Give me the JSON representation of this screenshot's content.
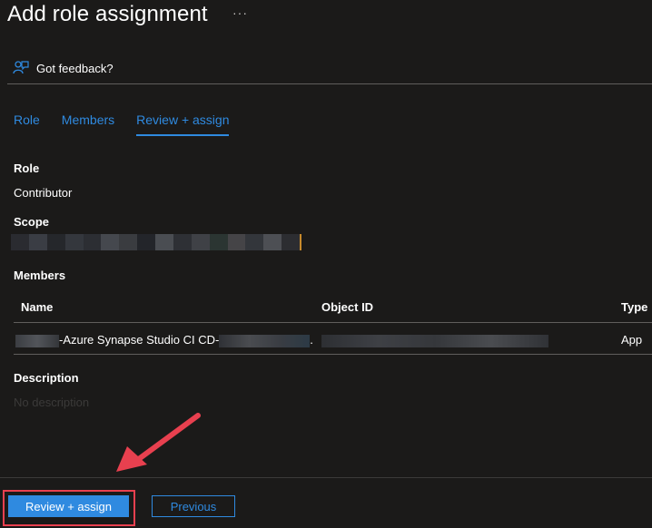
{
  "header": {
    "title": "Add role assignment",
    "more": "···"
  },
  "feedback": {
    "label": "Got feedback?"
  },
  "tabs": [
    {
      "label": "Role"
    },
    {
      "label": "Members"
    },
    {
      "label": "Review + assign"
    }
  ],
  "role": {
    "label": "Role",
    "value": "Contributor"
  },
  "scope": {
    "label": "Scope"
  },
  "members": {
    "label": "Members",
    "columns": [
      "Name",
      "Object ID",
      "Type"
    ],
    "rows": [
      {
        "name": "-Azure Synapse Studio CI CD-",
        "type": "App"
      }
    ]
  },
  "description": {
    "label": "Description",
    "value": "No description"
  },
  "footer": {
    "primary_label": "Review + assign",
    "secondary_label": "Previous"
  },
  "colors": {
    "accent": "#2f8ae0",
    "background": "#1b1a19",
    "highlight": "#e8404f"
  }
}
